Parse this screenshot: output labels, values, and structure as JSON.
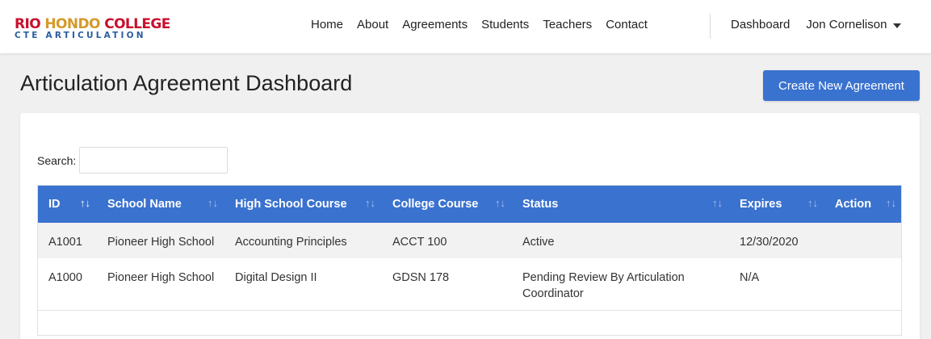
{
  "logo": {
    "line1_red_a": "RIO ",
    "line1_gold": "HONDO",
    "line1_red_b": " COLLEGE",
    "line2": "CTE ARTICULATION"
  },
  "nav": {
    "links": [
      "Home",
      "About",
      "Agreements",
      "Students",
      "Teachers",
      "Contact"
    ],
    "dashboard": "Dashboard",
    "user": "Jon Cornelison"
  },
  "page": {
    "title": "Articulation Agreement Dashboard",
    "create_button": "Create New Agreement"
  },
  "search": {
    "label": "Search:",
    "value": "",
    "placeholder": ""
  },
  "table": {
    "columns": [
      "ID",
      "School Name",
      "High School Course",
      "College Course",
      "Status",
      "Expires",
      "Action"
    ],
    "rows": [
      {
        "id": "A1001",
        "school": "Pioneer High School",
        "hs_course": "Accounting Principles",
        "college_course": "ACCT 100",
        "status": "Active",
        "expires": "12/30/2020",
        "action": ""
      },
      {
        "id": "A1000",
        "school": "Pioneer High School",
        "hs_course": "Digital Design II",
        "college_course": "GDSN 178",
        "status": "Pending Review By Articulation Coordinator",
        "expires": "N/A",
        "action": ""
      }
    ]
  },
  "colors": {
    "primary": "#3a72cf",
    "logo_red": "#c8102e",
    "logo_gold": "#d49a2a",
    "logo_blue": "#2a5d9f"
  }
}
